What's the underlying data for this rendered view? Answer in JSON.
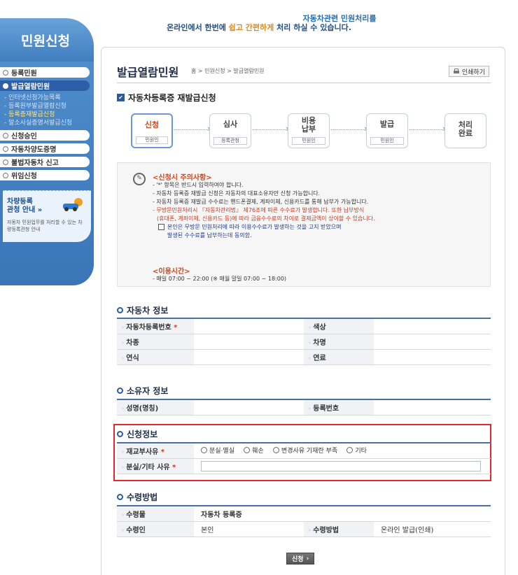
{
  "banner": {
    "line1": "자동차관련 민원처리를",
    "line2_a": "온라인에서 한번에 ",
    "line2_hl": "쉽고 간편하게",
    "line2_b": " 처리 하실 수 있습니다."
  },
  "sidebar": {
    "title": "민원신청",
    "items": [
      {
        "label": "등록민원"
      },
      {
        "label": "발급열람민원"
      },
      {
        "label": "신청승인"
      },
      {
        "label": "자동차양도증명"
      },
      {
        "label": "불법자동차 신고"
      },
      {
        "label": "위임신청"
      }
    ],
    "subitems": [
      {
        "label": "- 인터넷신청가능목록"
      },
      {
        "label": "- 등록원부발급열람신청"
      },
      {
        "label": "- 등록증재발급신청"
      },
      {
        "label": "- 말소사실증명서발급신청"
      }
    ],
    "promo": {
      "title_line1": "차량등록",
      "title_line2": "관청 안내 »",
      "desc": "자동차 민원업무를 처리할 수 있는 차량등록관청 안내"
    }
  },
  "header": {
    "page_title": "발급열람민원",
    "breadcrumb": "홈 > 민원신청 > 발급열람민원",
    "print_label": "인쇄하기"
  },
  "form_title": "자동차등록증 재발급신청",
  "steps": [
    {
      "label": "신청",
      "who": "민원인"
    },
    {
      "label": "심사",
      "who": "등록관청"
    },
    {
      "label": "비용\n납부",
      "who": "민원인"
    },
    {
      "label": "발급",
      "who": "민원인"
    },
    {
      "label": "처리\n완료",
      "who": ""
    }
  ],
  "notice": {
    "title": "<신청시 주의사항>",
    "lines": [
      "- '*' 항목은 반드시 입력하여야 합니다.",
      "- 자동차 등록증 재발급 신청은 자동차의 대표소유자만 신청 가능합니다.",
      "- 자동차 등록증 재발급 수수료는 핸드폰결제, 계좌이체, 신용카드를 통해 납부가 가능합니다."
    ],
    "red_line1": "- 무방문민원처리시 『자동차관리법』 제76조에 따른 수수료가 발생합니다. 또한 납부방식",
    "red_line2": "(휴대폰, 계좌이체, 신용카드 등)에 따라 금융수수료의 차이로 결제금액이 상이할 수 있습니다.",
    "agree_line1": "본인은 무방문 민원처리에 따라 이용수수료가 발생하는 것을 고지 받았으며",
    "agree_line2": "발생된 수수료를 납부하는데 동의함.",
    "time_title": "<이용시간>",
    "time_line": "- 매일 07:00 ~ 22:00 (※ 매월 말일 07:00 ~ 18:00)"
  },
  "vehicle": {
    "title": "자동차 정보",
    "reg_no_label": "자동차등록번호",
    "color_label": "색상",
    "type_label": "차종",
    "name_label": "차명",
    "year_label": "연식",
    "fuel_label": "연료"
  },
  "owner": {
    "title": "소유자 정보",
    "name_label": "성명(명칭)",
    "reg_label": "등록번호"
  },
  "application": {
    "title": "신청정보",
    "reason_label": "재교부사유",
    "reason_options": [
      "분실·멸실",
      "훼손",
      "변경사유 기재란 부족",
      "기타"
    ],
    "detail_label": "분실/기타 사유"
  },
  "receive": {
    "title": "수령방법",
    "item_label": "수령물",
    "item_value": "자동차 등록증",
    "receiver_label": "수령인",
    "receiver_value": "본인",
    "method_label": "수령방법",
    "method_value": "온라인 발급(인쇄)"
  },
  "submit_label": "신청",
  "required_mark": "*",
  "colors": {
    "accent": "#2d5b9a",
    "alert": "#d0361c",
    "highlight_box": "#e1282e"
  }
}
